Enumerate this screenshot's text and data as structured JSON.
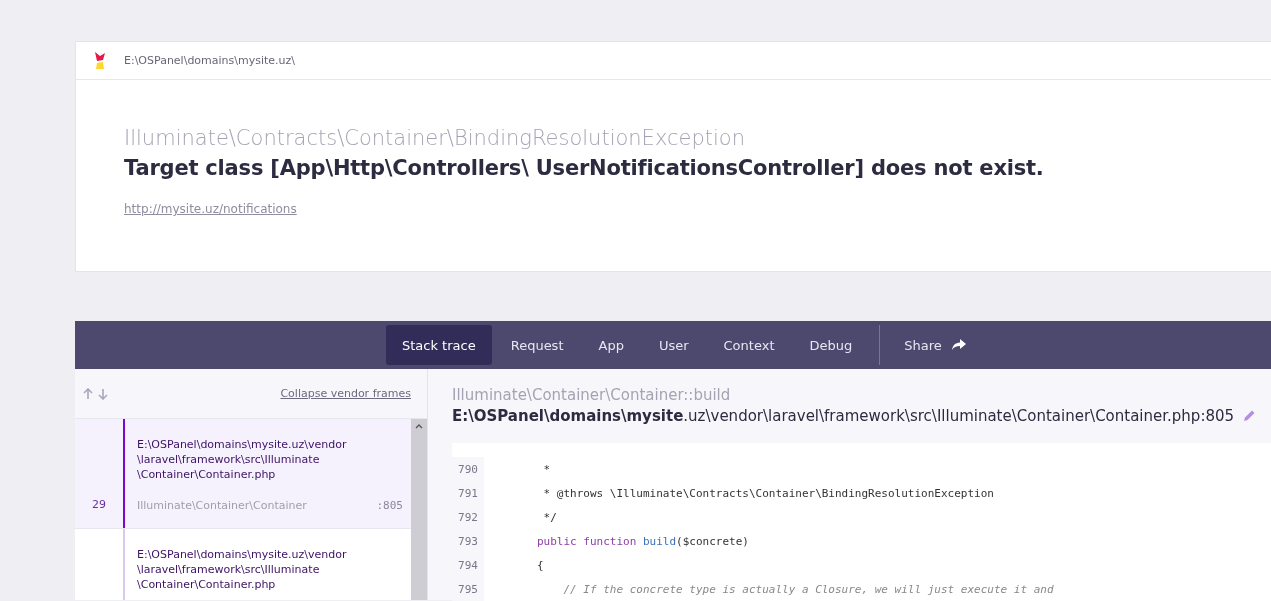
{
  "header": {
    "path": "E:\\OSPanel\\domains\\mysite.uz\\"
  },
  "exception": {
    "class": "Illuminate\\Contracts\\Container\\BindingResolutionException",
    "message": "Target class [App\\Http\\Controllers\\ UserNotificationsController] does not exist.",
    "url": "http://mysite.uz/notifications"
  },
  "tabs": [
    {
      "label": "Stack trace",
      "selected": true,
      "kind": "tab"
    },
    {
      "label": "Request",
      "selected": false,
      "kind": "tab"
    },
    {
      "label": "App",
      "selected": false,
      "kind": "tab"
    },
    {
      "label": "User",
      "selected": false,
      "kind": "tab"
    },
    {
      "label": "Context",
      "selected": false,
      "kind": "tab"
    },
    {
      "label": "Debug",
      "selected": false,
      "kind": "tab"
    },
    {
      "label": "Share",
      "selected": false,
      "kind": "share"
    }
  ],
  "frames_toolbar": {
    "collapse_link": "Collapse vendor frames"
  },
  "frames": [
    {
      "file": "E:\\OSPanel\\domains\\mysite.uz\\vendor \\laravel\\framework\\src\\Illuminate \\Container\\Container.php",
      "number": "29",
      "class": "Illuminate\\Container\\Container",
      "line": ":805",
      "selected": true
    },
    {
      "file": "E:\\OSPanel\\domains\\mysite.uz\\vendor \\laravel\\framework\\src\\Illuminate \\Container\\Container.php",
      "selected": false
    }
  ],
  "frame_detail": {
    "method": "Illuminate\\Container\\Container::build",
    "file": "**E:\\OSPanel\\domains\\mysite**.uz\\vendor\\laravel\\framework\\src\\Illuminate\\Container\\Container.php:805"
  },
  "code_lines": [
    {
      "number": "790",
      "tokens": [
        {
          "text": "         *",
          "kind": "plain"
        }
      ]
    },
    {
      "number": "791",
      "tokens": [
        {
          "text": "         * @throws \\Illuminate\\Contracts\\Container\\BindingResolutionException",
          "kind": "plain"
        }
      ]
    },
    {
      "number": "792",
      "tokens": [
        {
          "text": "         */",
          "kind": "plain"
        }
      ]
    },
    {
      "number": "793",
      "tokens": [
        {
          "text": "        public function",
          "kind": "keyword"
        },
        {
          "text": " build",
          "kind": "func"
        },
        {
          "text": "($concrete)",
          "kind": "plain"
        }
      ]
    },
    {
      "number": "794",
      "tokens": [
        {
          "text": "        {",
          "kind": "plain"
        }
      ]
    },
    {
      "number": "795",
      "tokens": [
        {
          "text": "            // If the concrete type is actually a Closure, we will just execute it and",
          "kind": "comment"
        }
      ]
    }
  ]
}
